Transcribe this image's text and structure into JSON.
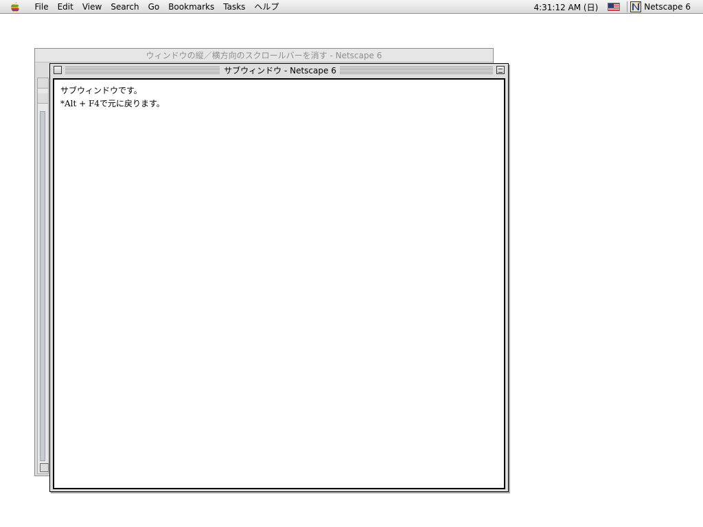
{
  "menubar": {
    "items": [
      "File",
      "Edit",
      "View",
      "Search",
      "Go",
      "Bookmarks",
      "Tasks",
      "ヘルプ"
    ],
    "clock": "4:31:12 AM (日)",
    "app_name": "Netscape 6"
  },
  "back_window": {
    "title": "ウィンドウの縦／横方向のスクロールバーを消す - Netscape 6"
  },
  "front_window": {
    "title": "サブウィンドウ - Netscape 6",
    "lines": [
      "サブウィンドウです。",
      "*Alt + F4で元に戻ります。"
    ]
  },
  "colors": {
    "menubar": "#dcdcdc",
    "window_chrome": "#dedede",
    "inactive_title": "#8e8e8e"
  }
}
